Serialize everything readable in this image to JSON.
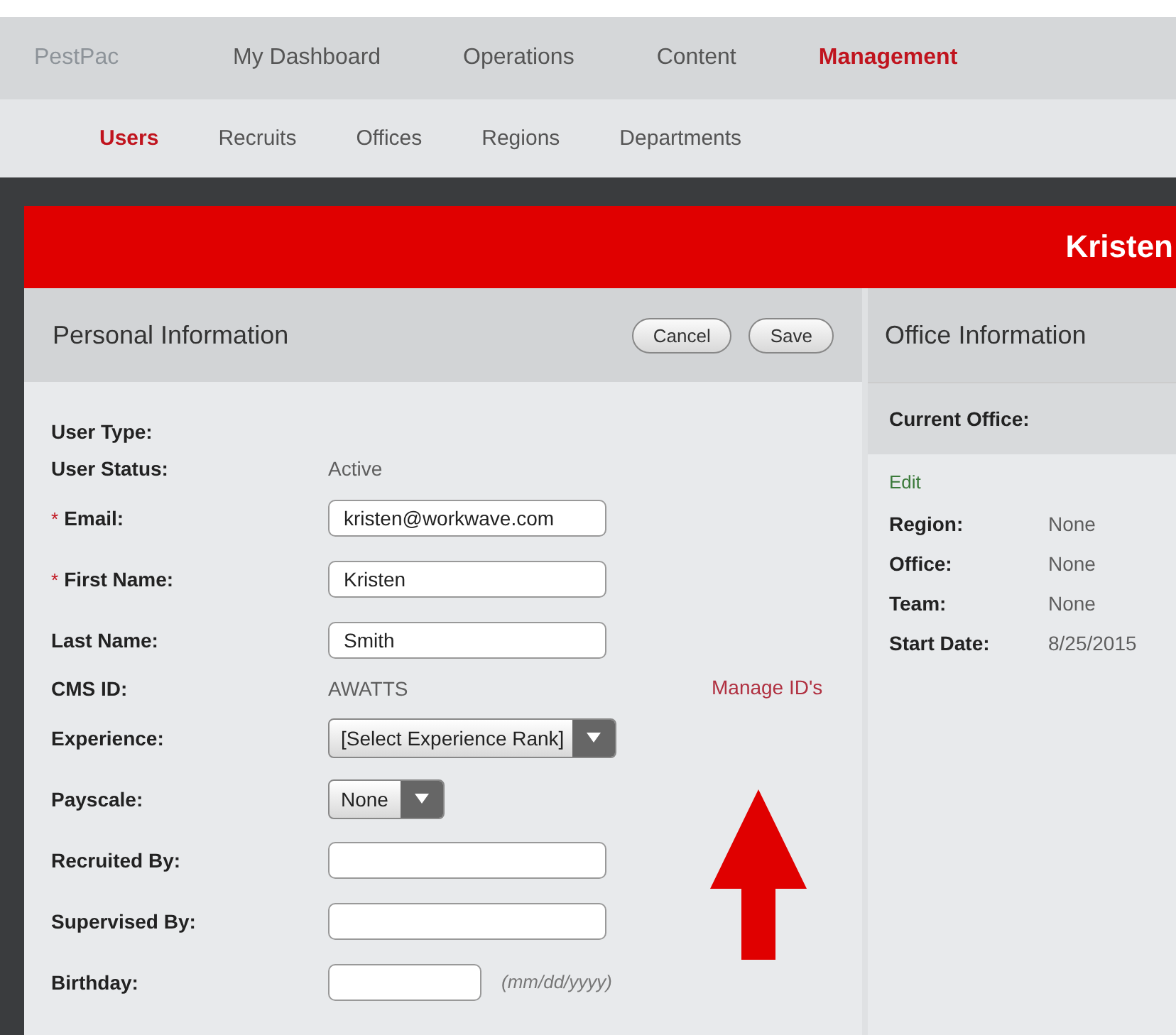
{
  "brand": "PestPac",
  "nav": [
    {
      "label": "My Dashboard",
      "selected": false
    },
    {
      "label": "Operations",
      "selected": false
    },
    {
      "label": "Content",
      "selected": false
    },
    {
      "label": "Management",
      "selected": true
    }
  ],
  "subnav": [
    {
      "label": "Users",
      "selected": true
    },
    {
      "label": "Recruits",
      "selected": false
    },
    {
      "label": "Offices",
      "selected": false
    },
    {
      "label": "Regions",
      "selected": false
    },
    {
      "label": "Departments",
      "selected": false
    }
  ],
  "banner": {
    "title": "Kristen"
  },
  "personal": {
    "title": "Personal Information",
    "buttons": [
      "Cancel",
      "Save"
    ],
    "rows": [
      {
        "kind": "text",
        "label": "User Type:"
      },
      {
        "kind": "text",
        "label": "User Status:",
        "value": "Active"
      },
      {
        "kind": "input",
        "required_mark": "*",
        "label": "Email:",
        "value": "kristen@workwave.com"
      },
      {
        "kind": "input",
        "required_mark": "*",
        "label": "First Name:",
        "value": "Kristen"
      },
      {
        "kind": "input",
        "label": "Last Name:",
        "value": "Smith"
      },
      {
        "kind": "text",
        "label": "CMS ID:",
        "value": "AWATTS",
        "link": "Manage ID's"
      },
      {
        "kind": "select",
        "label": "Experience:",
        "value": "[Select Experience Rank]"
      },
      {
        "kind": "select",
        "label": "Payscale:",
        "value": "None"
      },
      {
        "kind": "input",
        "label": "Recruited By:"
      },
      {
        "kind": "input",
        "label": "Supervised By:"
      },
      {
        "kind": "date",
        "label": "Birthday:",
        "hint": "(mm/dd/yyyy)"
      }
    ]
  },
  "office": {
    "title": "Office Information",
    "section": "Current Office:",
    "edit": "Edit",
    "rows": [
      {
        "label": "Region:",
        "value": "None"
      },
      {
        "label": "Office:",
        "value": "None"
      },
      {
        "label": "Team:",
        "value": "None"
      },
      {
        "label": "Start Date:",
        "value": "8/25/2015"
      }
    ]
  }
}
